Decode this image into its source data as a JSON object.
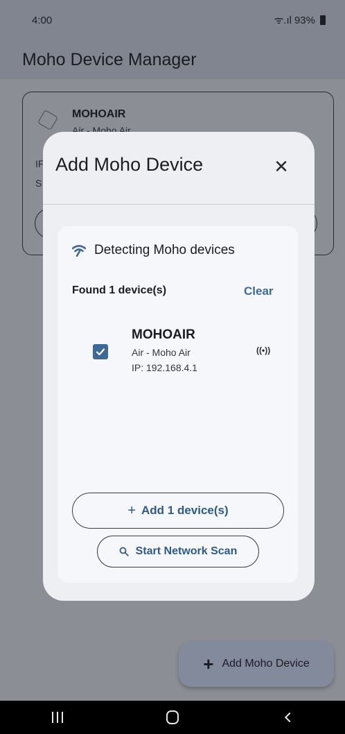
{
  "status_bar": {
    "time": "4:00",
    "battery": "93%",
    "signal": "ᯤ.ıl"
  },
  "app_bar": {
    "title": "Moho Device Manager"
  },
  "background_card": {
    "name": "MOHOAIR",
    "subtitle": "Air - Moho Air",
    "edge_i": "IF",
    "edge_s": "S"
  },
  "dialog": {
    "title": "Add Moho Device",
    "close_glyph": "✕",
    "detect_text": "Detecting Moho devices",
    "found_text": "Found 1 device(s)",
    "clear_label": "Clear",
    "devices": [
      {
        "name": "MOHOAIR",
        "type": "Air - Moho Air",
        "ip": "IP: 192.168.4.1",
        "checked": true,
        "signal_glyph": "((•))"
      }
    ],
    "add_button": {
      "icon": "+",
      "label": "Add 1 device(s)"
    },
    "scan_button": {
      "label": "Start Network Scan"
    }
  },
  "fab": {
    "icon": "+",
    "label": "Add Moho Device"
  },
  "icons": [
    "wifi-icon",
    "close-icon",
    "check-icon",
    "signal-icon",
    "plus-icon",
    "search-icon"
  ],
  "colors": {
    "accent": "#3f6a94",
    "checkbox": "#3d6994",
    "scrim": "#8c8e96"
  }
}
